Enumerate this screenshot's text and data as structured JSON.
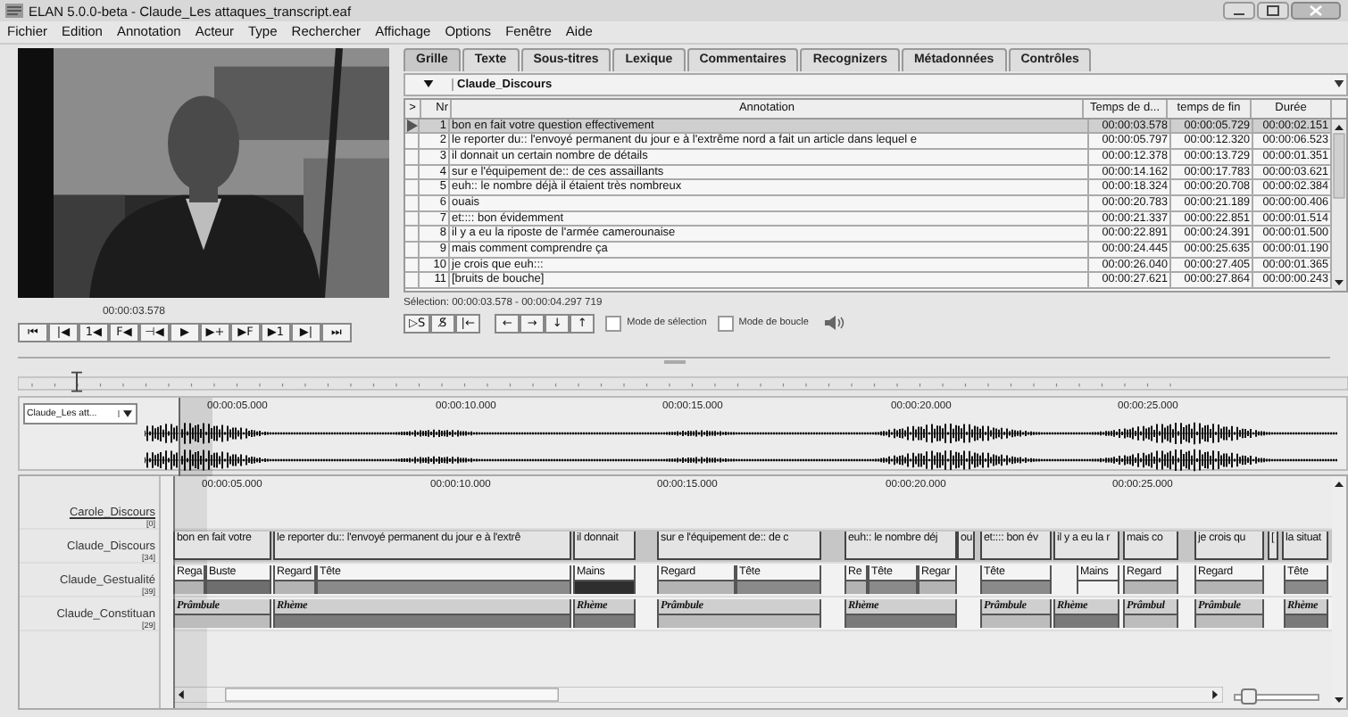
{
  "window": {
    "title": "ELAN 5.0.0-beta - Claude_Les attaques_transcript.eaf"
  },
  "menu": [
    "Fichier",
    "Edition",
    "Annotation",
    "Acteur",
    "Type",
    "Rechercher",
    "Affichage",
    "Options",
    "Fenêtre",
    "Aide"
  ],
  "player": {
    "time": "00:00:03.578",
    "buttons": [
      "⏮",
      "|◀",
      "1◀",
      "F◀",
      "⊣◀",
      "▶",
      "▶+",
      "▶F",
      "▶1",
      "▶|",
      "⏭"
    ]
  },
  "tabs": [
    {
      "label": "Grille",
      "selected": true
    },
    {
      "label": "Texte",
      "selected": false
    },
    {
      "label": "Sous-titres",
      "selected": false
    },
    {
      "label": "Lexique",
      "selected": false
    },
    {
      "label": "Commentaires",
      "selected": false
    },
    {
      "label": "Recognizers",
      "selected": false
    },
    {
      "label": "Métadonnées",
      "selected": false
    },
    {
      "label": "Contrôles",
      "selected": false
    }
  ],
  "grid": {
    "tier": "Claude_Discours",
    "columns": [
      ">",
      "Nr",
      "Annotation",
      "Temps de d...",
      "temps de fin",
      "Durée"
    ],
    "rows": [
      {
        "nr": "1",
        "annotation": "bon en fait votre question effectivement",
        "begin": "00:00:03.578",
        "end": "00:00:05.729",
        "duration": "00:00:02.151",
        "selected": true
      },
      {
        "nr": "2",
        "annotation": "le reporter du:: l'envoyé permanent du jour e à l'extrême nord a fait un article dans lequel e",
        "begin": "00:00:05.797",
        "end": "00:00:12.320",
        "duration": "00:00:06.523",
        "selected": false
      },
      {
        "nr": "3",
        "annotation": "il donnait un certain nombre de détails",
        "begin": "00:00:12.378",
        "end": "00:00:13.729",
        "duration": "00:00:01.351",
        "selected": false
      },
      {
        "nr": "4",
        "annotation": "sur e l'équipement de:: de ces assaillants",
        "begin": "00:00:14.162",
        "end": "00:00:17.783",
        "duration": "00:00:03.621",
        "selected": false
      },
      {
        "nr": "5",
        "annotation": "euh:: le nombre déjà il étaient très nombreux",
        "begin": "00:00:18.324",
        "end": "00:00:20.708",
        "duration": "00:00:02.384",
        "selected": false
      },
      {
        "nr": "6",
        "annotation": "ouais",
        "begin": "00:00:20.783",
        "end": "00:00:21.189",
        "duration": "00:00:00.406",
        "selected": false
      },
      {
        "nr": "7",
        "annotation": "et:::: bon évidemment",
        "begin": "00:00:21.337",
        "end": "00:00:22.851",
        "duration": "00:00:01.514",
        "selected": false
      },
      {
        "nr": "8",
        "annotation": "il y a eu la riposte de l'armée camerounaise",
        "begin": "00:00:22.891",
        "end": "00:00:24.391",
        "duration": "00:00:01.500",
        "selected": false
      },
      {
        "nr": "9",
        "annotation": "mais comment comprendre ça",
        "begin": "00:00:24.445",
        "end": "00:00:25.635",
        "duration": "00:00:01.190",
        "selected": false
      },
      {
        "nr": "10",
        "annotation": "je crois que euh:::",
        "begin": "00:00:26.040",
        "end": "00:00:27.405",
        "duration": "00:00:01.365",
        "selected": false
      },
      {
        "nr": "11",
        "annotation": "[bruits de bouche]",
        "begin": "00:00:27.621",
        "end": "00:00:27.864",
        "duration": "00:00:00.243",
        "selected": false
      }
    ]
  },
  "selection": "Sélection: 00:00:03.578 - 00:00:04.297  719",
  "edit_buttons": [
    "▷S",
    "S̸",
    "|←"
  ],
  "nav_buttons": [
    "←",
    "→",
    "↓",
    "↑"
  ],
  "options": [
    {
      "label": "Mode de sélection",
      "checked": false
    },
    {
      "label": "Mode de boucle",
      "checked": false
    }
  ],
  "waveform": {
    "track": "Claude_Les att...",
    "times": [
      "00:00:05.000",
      "00:00:10.000",
      "00:00:15.000",
      "00:00:20.000",
      "00:00:25.000"
    ]
  },
  "timeline": {
    "times": [
      "00:00:05.000",
      "00:00:10.000",
      "00:00:15.000",
      "00:00:20.000",
      "00:00:25.000"
    ],
    "zoom_slider": {
      "level": 0.1
    },
    "tiers": [
      {
        "name": "Carole_Discours",
        "count": "[0]",
        "kind": "empty"
      },
      {
        "name": "Claude_Discours",
        "count": "[34]",
        "kind": "text",
        "annotations": [
          {
            "text": "bon en fait votre"
          },
          {
            "text": "le reporter du:: l'envoyé permanent du jour e à l'extrê"
          },
          {
            "text": "il donnait"
          },
          {
            "text": "sur e l'équipement de:: de c"
          },
          {
            "text": "euh:: le nombre déj"
          },
          {
            "text": "ou"
          },
          {
            "text": "et:::: bon év"
          },
          {
            "text": "il y a eu la r"
          },
          {
            "text": "mais co"
          },
          {
            "text": "je crois qu"
          },
          {
            "text": "["
          },
          {
            "text": "la situat"
          }
        ]
      },
      {
        "name": "Claude_Gestualité",
        "count": "[39]",
        "kind": "bar",
        "annotations": [
          {
            "text": "Rega",
            "color": "#b4b4b4"
          },
          {
            "text": "Buste",
            "color": "#6e6e6e"
          },
          {
            "text": "Regard",
            "color": "#b4b4b4"
          },
          {
            "text": "Tête",
            "color": "#8a8a8a"
          },
          {
            "text": "Mains",
            "color": "#2e2e2e"
          },
          {
            "text": "Regard",
            "color": "#b4b4b4"
          },
          {
            "text": "Tête",
            "color": "#8a8a8a"
          },
          {
            "text": "Re",
            "color": "#b4b4b4"
          },
          {
            "text": "Tête",
            "color": "#8a8a8a"
          },
          {
            "text": "Regar",
            "color": "#b4b4b4"
          },
          {
            "text": "Tête",
            "color": "#8a8a8a"
          },
          {
            "text": "Mains",
            "color": "#f2f2f2"
          },
          {
            "text": "Regard",
            "color": "#b4b4b4"
          },
          {
            "text": "Regard",
            "color": "#b4b4b4"
          },
          {
            "text": "Tête",
            "color": "#8a8a8a"
          }
        ]
      },
      {
        "name": "Claude_Constituan",
        "count": "[29]",
        "kind": "bar",
        "annotations": [
          {
            "text": "Prâmbule",
            "color": "#bcbcbc"
          },
          {
            "text": "Rhème",
            "color": "#7a7a7a"
          },
          {
            "text": "Rhème",
            "color": "#7a7a7a"
          },
          {
            "text": "Prâmbule",
            "color": "#bcbcbc"
          },
          {
            "text": "Rhème",
            "color": "#7a7a7a"
          },
          {
            "text": "Prâmbule",
            "color": "#bcbcbc"
          },
          {
            "text": "Rhème",
            "color": "#7a7a7a"
          },
          {
            "text": "Prâmbul",
            "color": "#bcbcbc"
          },
          {
            "text": "Prâmbule",
            "color": "#bcbcbc"
          },
          {
            "text": "Rhème",
            "color": "#7a7a7a"
          }
        ]
      }
    ]
  }
}
